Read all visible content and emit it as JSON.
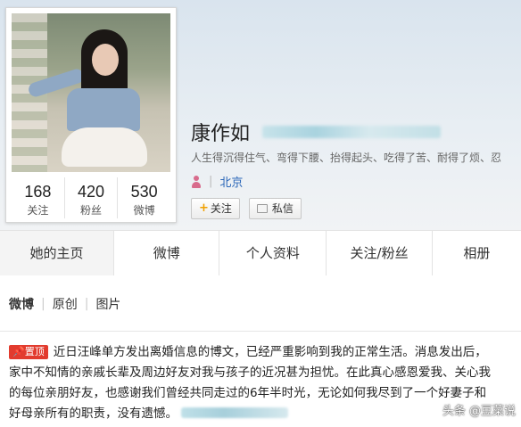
{
  "profile": {
    "name": "康作如",
    "bio": "人生得沉得住气、弯得下腰、抬得起头、吃得了苦、耐得了烦、忍",
    "location": "北京",
    "stats": [
      {
        "num": "168",
        "label": "关注"
      },
      {
        "num": "420",
        "label": "粉丝"
      },
      {
        "num": "530",
        "label": "微博"
      }
    ],
    "follow_label": "关注",
    "message_label": "私信"
  },
  "tabs": [
    {
      "label": "她的主页"
    },
    {
      "label": "微博"
    },
    {
      "label": "个人资料"
    },
    {
      "label": "关注/粉丝"
    },
    {
      "label": "相册"
    }
  ],
  "subtabs": [
    "微博",
    "原创",
    "图片"
  ],
  "post": {
    "badge": "置顶",
    "lines": [
      "近日汪峰单方发出离婚信息的博文，已经严重影响到我的正常生活。消息发出后，",
      "家中不知情的亲戚长辈及周边好友对我与孩子的近况甚为担忧。在此真心感恩爱我、关心我",
      "的每位亲朋好友，也感谢我们曾经共同走过的6年半时光，无论如何我尽到了一个好妻子和",
      "好母亲所有的职责，没有遗憾。"
    ]
  },
  "watermark": "头条 @豆菜说"
}
